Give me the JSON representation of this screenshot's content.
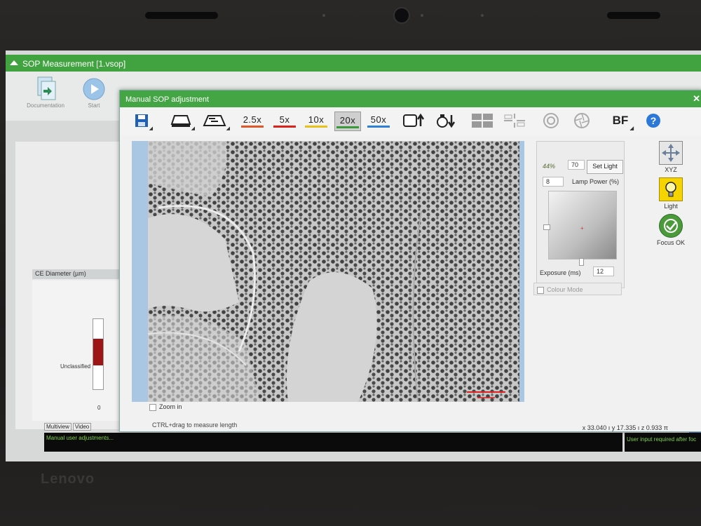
{
  "main_window": {
    "title": "SOP Measurement [1.vsop]",
    "toolbar": [
      {
        "label": "Documentation",
        "icon": "documentation-icon"
      },
      {
        "label": "Start",
        "icon": "play-icon"
      }
    ],
    "chart_panel": {
      "header": "CE Diameter (µm)",
      "bar_label": "Unclassified",
      "axis_zero": "0"
    },
    "bottom_tabs": [
      "Multiview",
      "Video"
    ],
    "status_left": "Manual user adjustments...",
    "status_right": "User input required after foc"
  },
  "dialog": {
    "title": "Manual SOP adjustment",
    "toolbar": {
      "magnifications": [
        {
          "label": "2.5x",
          "color": "#e0572a"
        },
        {
          "label": "5x",
          "color": "#d9231f"
        },
        {
          "label": "10x",
          "color": "#e8c21a"
        },
        {
          "label": "20x",
          "color": "#3a9a3a",
          "selected": true
        },
        {
          "label": "50x",
          "color": "#2f7fd6"
        }
      ],
      "mode_label": "BF"
    },
    "viewer": {
      "zoom_in_label": "Zoom in",
      "hint": "CTRL+drag to measure length",
      "coords": "x 33.040 ı y 17.335 ı z 0.933 π"
    },
    "light_panel": {
      "percent": "44%",
      "lamp_value": "70",
      "set_light_label": "Set Light",
      "lamp_field": "8",
      "lamp_power_label": "Lamp Power (%)",
      "exposure_label": "Exposure (ms)",
      "exposure_value": "12",
      "colour_mode_label": "Colour Mode"
    },
    "side_buttons": [
      {
        "label": "XYZ",
        "icon": "xyz-arrows-icon"
      },
      {
        "label": "Light",
        "icon": "light-bulb-icon"
      },
      {
        "label": "Focus OK",
        "icon": "focus-ok-icon"
      }
    ]
  },
  "device": {
    "brand": "Lenovo"
  }
}
